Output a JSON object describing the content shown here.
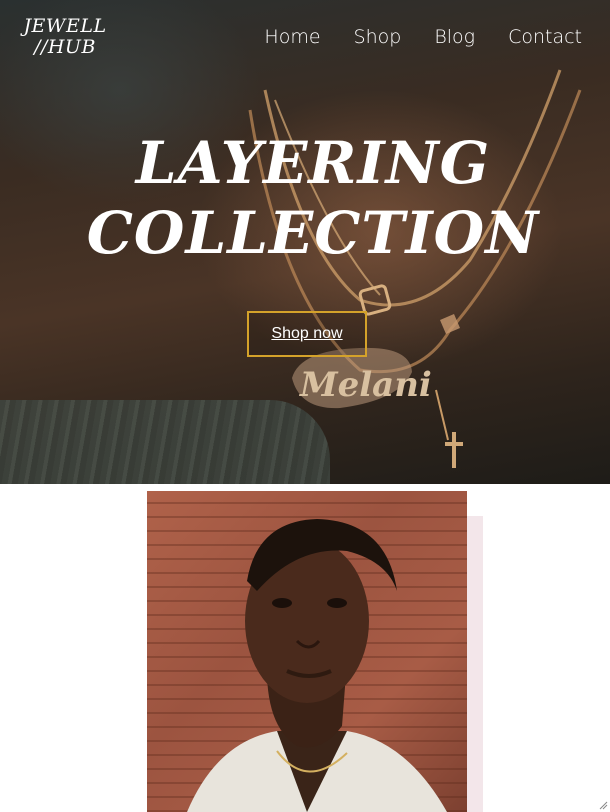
{
  "brand": {
    "line1": "JEWELL",
    "line2": "//HUB"
  },
  "nav": {
    "items": [
      {
        "label": "Home"
      },
      {
        "label": "Shop"
      },
      {
        "label": "Blog"
      },
      {
        "label": "Contact"
      }
    ]
  },
  "hero": {
    "title_line1": "LAYERING",
    "title_line2": "COLLECTION",
    "cta_label": "Shop now",
    "pendant_text": "Melani"
  },
  "colors": {
    "accent": "#d4a22a",
    "portrait_shadow": "#f3e6ea",
    "text_light": "#ffffff"
  },
  "icons": [
    "resize-grip-icon"
  ]
}
